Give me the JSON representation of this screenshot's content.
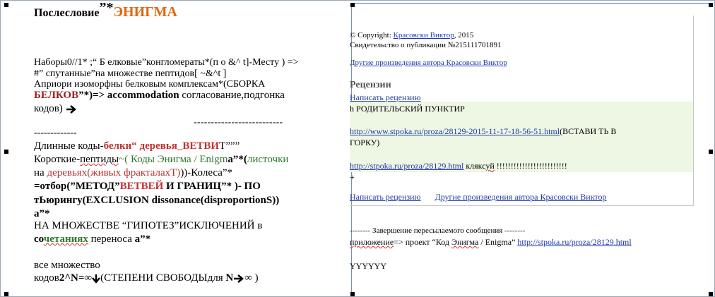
{
  "left": {
    "title_a": "Послесловие",
    "title_b": "”*",
    "title_c": "ЭНИГМА",
    "p1_l1": "Наборы0//1* ;“ Б елковые”конгломераты*(п о  &^ t]-Месту ) =>",
    "p1_l2": "#” спутанные”на множестве пептидов[ ~&^t ]",
    "p1_l3": "Априори изоморфны белковым комплексам*(СБОРКА",
    "p1_l4a": "БЕЛКОВ",
    "p1_l4b": "”*)=> ",
    "p1_l4c": "accommodation",
    "p1_l4d": " согласование,подгонка",
    "p1_l5": "кодов)",
    "dashes_1": "--------------------------",
    "dashes_2": "-------------",
    "p2_l1a": "Длинные коды-",
    "p2_l1b": "белки",
    "p2_l1c": "“ деревья_ВЕТВИ",
    "p2_l1d": "Т”””",
    "p2_l2a": "Короткие-",
    "p2_l2b": "пептиды",
    "p2_l2c": "~( Коды Энигма / Enigm",
    "p2_l2d": "а”*(",
    "p2_l2e": "листочки",
    "p2_l3a": "на ",
    "p2_l3b": "деревьях(живых фракталахТ)",
    "p2_l3c": "))-Колеса”*",
    "p2_l4a": "=отбор(”МЕТОД”",
    "p2_l4b": "ВЕТВЕЙ",
    "p2_l4c": " И ГРАНИЦ”* )- ПО",
    "p2_l5": "тЬюрингу(EXCLUSION dissonance(disproportionS))",
    "p2_l6": "а”*",
    "p2_l7": "НА МНОЖЕСТВЕ “ГИПОТЕЗ”ИСКЛЮЧЕНИЙ в",
    "p2_l8a": "со",
    "p2_l8b": "четаниях",
    "p2_l8c": " переноса ",
    "p2_l8d": "а",
    "p2_l8e": "”*",
    "p3_l1": "все множество",
    "p3_l2a": "кодов",
    "p3_l2b": "2^N=∞",
    "p3_l2c": "(СТЕПЕНИ СВОБОДЫдля ",
    "p3_l2d": "N",
    "p3_l2e": "∞ )"
  },
  "right": {
    "copyright_pre": "© Copyright: ",
    "copyright_author": "Красовски Виктор",
    "copyright_year": ", 2015",
    "certificate": "Свидетельство о публикации №215111701891",
    "other_works": "Другие произведения автора Красовски Виктор",
    "reviews_heading": "Рецензии",
    "write_review": "Написать рецензию",
    "green_l1": "h РОДИТЕЛЬСКИЙ ПУНКТИР",
    "green_link1": "http://www.stpoka.ru/proza/28129-2015-11-17-18-56-51.html",
    "green_l2_tail": "(ВСТАВИ ТЬ В",
    "green_l3": "ГОРКУ)",
    "green_link2": "http://stpoka.ru/proza/28129.html",
    "green_l4_mid": " ",
    "green_l4_word": "клякс",
    "green_l4_word2": "уй",
    "green_l4_tail": " !!!!!!!!!!!!!!!!!!!!!!!!!",
    "plus": "+",
    "write_review2": "Написать рецензию",
    "other_works2": "Другие произведения автора Красовски Виктор",
    "forward_end": "-------- Завершение пересылаемого сообщения --------",
    "attach_word": "приложение",
    "attach_mid": "=>  проект “Код ",
    "attach_enigma": "Энигма",
    "attach_mid2": " / Enigma” ",
    "attach_link": "http://stpoka.ru/proza/28129.html",
    "yyy": "YYYYYY"
  },
  "colors": {
    "red": "#c0322f",
    "orange": "#e0670f",
    "green": "#2f7a2c",
    "link": "#1f3aa8"
  }
}
